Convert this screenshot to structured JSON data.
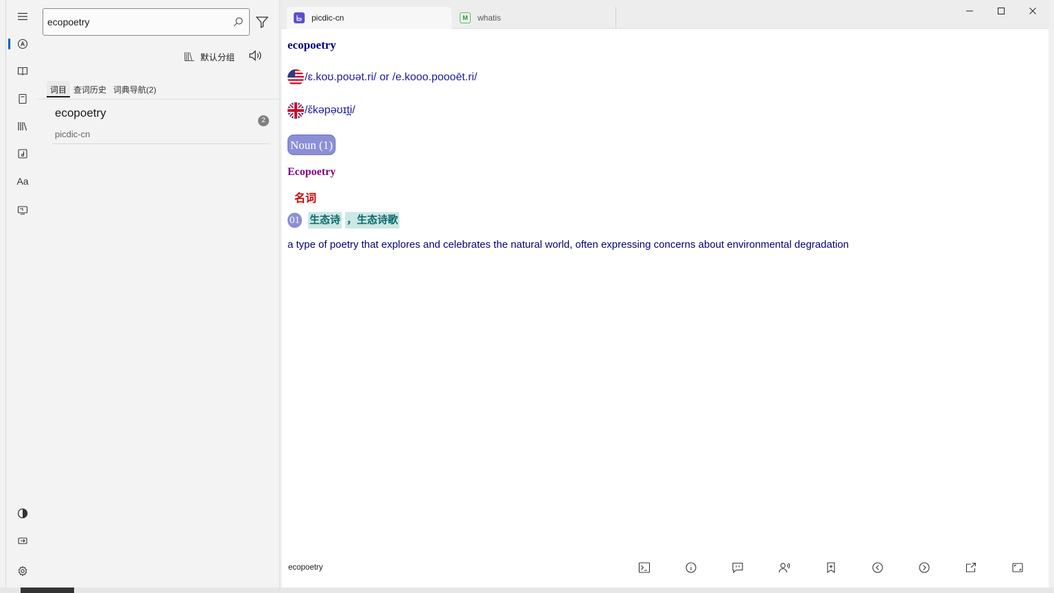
{
  "search": {
    "value": "ecopoetry",
    "placeholder": ""
  },
  "group": {
    "label": "默认分组"
  },
  "panel_tabs": [
    {
      "label": "词目"
    },
    {
      "label": "查词历史"
    },
    {
      "label": "词典导航(2)"
    }
  ],
  "results": [
    {
      "word": "ecopoetry",
      "dictionary": "picdic-cn",
      "count": "2"
    }
  ],
  "dict_tabs": [
    {
      "label": "picdic-cn",
      "icon": "picdic-icon",
      "active": true
    },
    {
      "label": "whatis",
      "icon": "whatis-icon",
      "active": false
    }
  ],
  "entry": {
    "headword": "ecopoetry",
    "pron_us": "/ɛ.koʊ.poʊət.ri/ or /e.kooo.poooēt.ri/",
    "pron_uk": "/ɛ̌kəpə̣ʊɪt̪i/",
    "pos_badge": "Noun (1)",
    "sense_title": "Ecopoetry",
    "pos_zh": "名词",
    "sense_number": "01",
    "translations": [
      "生态诗",
      "，生态诗歌"
    ],
    "definition": "a type of poetry that explores and celebrates the natural world, often expressing concerns about environmental degradation"
  },
  "bottom": {
    "word": "ecopoetry"
  },
  "colors": {
    "headword": "#000080",
    "sense_title": "#800080",
    "pos_zh": "#cc0000",
    "badge": "#8b8fd8",
    "tag_bg": "#cce8e4",
    "accent": "#005fb8"
  }
}
